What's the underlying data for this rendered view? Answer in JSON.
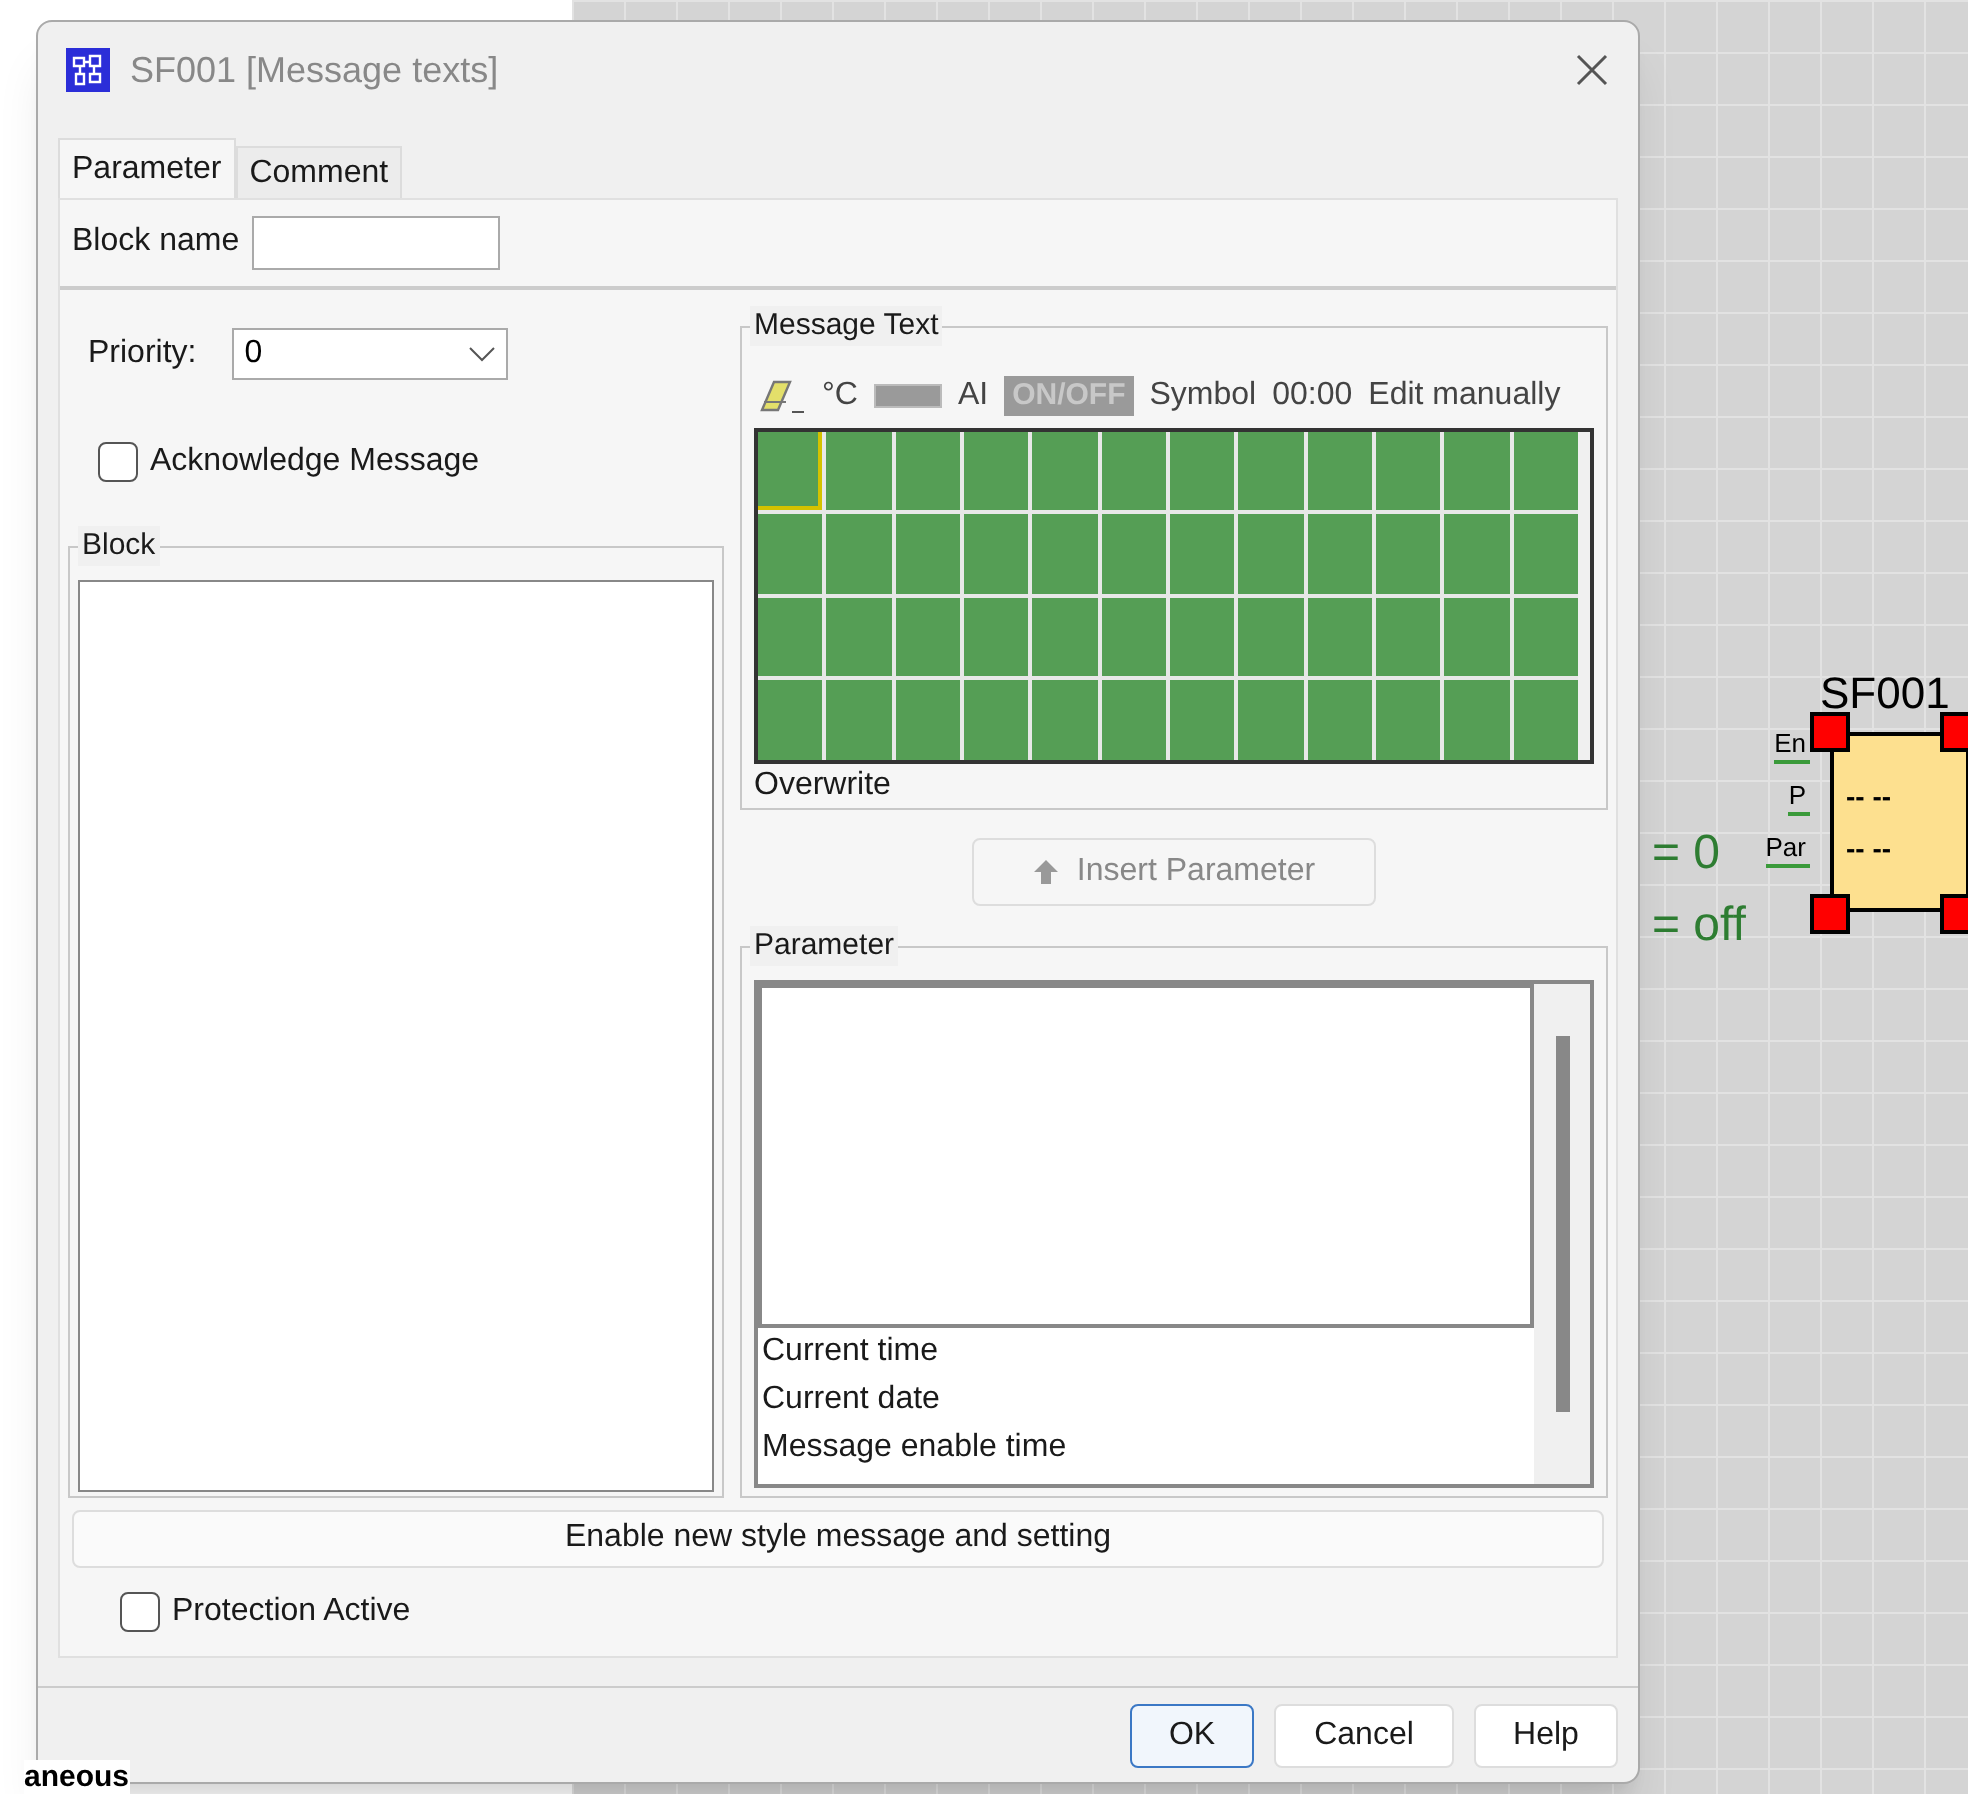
{
  "background": {
    "left_text": "aneous",
    "canvas": {
      "block_title": "SF001",
      "pins": [
        "En",
        "P",
        "Par"
      ],
      "lines": [
        "-- --",
        "-- --"
      ],
      "values": [
        "= 0",
        "= off"
      ]
    }
  },
  "window": {
    "title": "SF001 [Message texts]"
  },
  "tabs": [
    {
      "label": "Parameter",
      "selected": true
    },
    {
      "label": "Comment",
      "selected": false
    }
  ],
  "block_name": {
    "label": "Block name"
  },
  "priority": {
    "label": "Priority:",
    "value": "0"
  },
  "acknowledge": {
    "label": "Acknowledge Message",
    "checked": false
  },
  "block_group": {
    "title": "Block"
  },
  "message_text": {
    "title": "Message Text",
    "toolbar": [
      {
        "kind": "eraser"
      },
      {
        "kind": "text",
        "label": "°C"
      },
      {
        "kind": "bar"
      },
      {
        "kind": "text",
        "label": "AI"
      },
      {
        "kind": "chip",
        "label": "ON/OFF"
      },
      {
        "kind": "text",
        "label": "Symbol"
      },
      {
        "kind": "text",
        "label": "00:00"
      },
      {
        "kind": "text",
        "label": "Edit manually"
      }
    ],
    "mode": "Overwrite"
  },
  "insert_parameter": {
    "label": "Insert Parameter",
    "disabled": true
  },
  "parameter": {
    "title": "Parameter",
    "items": [
      "Current time",
      "Current date",
      "Message enable time"
    ]
  },
  "enable_button": {
    "label": "Enable new style message and setting"
  },
  "protection": {
    "label": "Protection Active",
    "checked": false
  },
  "buttons": [
    {
      "label": "OK",
      "default": true
    },
    {
      "label": "Cancel",
      "default": false
    },
    {
      "label": "Help",
      "default": false
    }
  ]
}
